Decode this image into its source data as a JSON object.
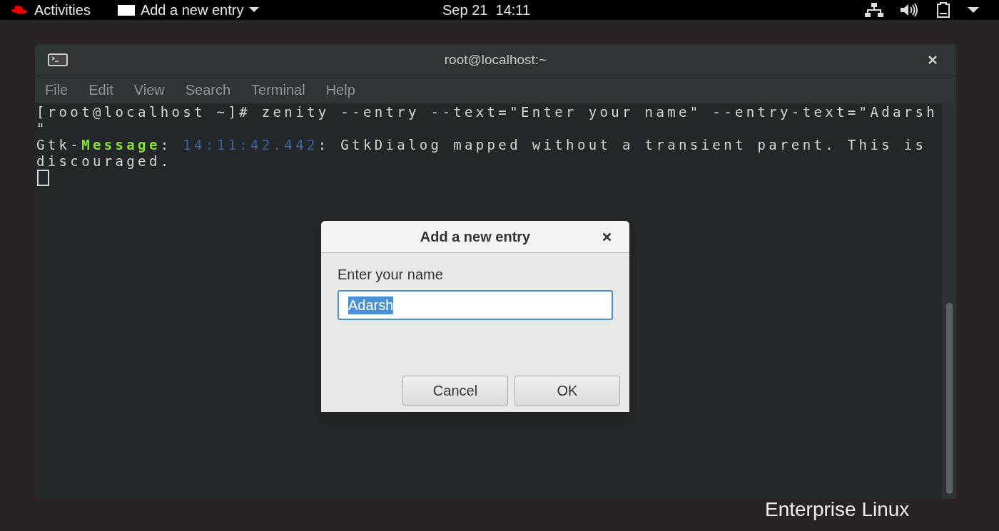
{
  "top_bar": {
    "activities": "Activities",
    "app_menu": "Add a new entry",
    "clock": "Sep 21  14:11"
  },
  "desktop": {
    "brand_text": "Enterprise Linux"
  },
  "terminal": {
    "title": "root@localhost:~",
    "menu": [
      "File",
      "Edit",
      "View",
      "Search",
      "Terminal",
      "Help"
    ],
    "lines": [
      [
        {
          "kind": "plain",
          "text": "[root@localhost ~]# zenity --entry --text=\"Enter your name\" --entry-text=\"Adarsh"
        }
      ],
      [
        {
          "kind": "plain",
          "text": "\""
        }
      ],
      [
        {
          "kind": "plain",
          "text": "Gtk-"
        },
        {
          "kind": "keyword",
          "text": "Message"
        },
        {
          "kind": "plain",
          "text": ": "
        },
        {
          "kind": "time",
          "text": "14:11:42.442"
        },
        {
          "kind": "plain",
          "text": ": GtkDialog mapped without a transient parent. This is"
        }
      ],
      [
        {
          "kind": "plain",
          "text": "discouraged."
        }
      ]
    ]
  },
  "dialog": {
    "title": "Add a new entry",
    "prompt": "Enter your name",
    "entry_value": "Adarsh",
    "buttons": [
      "Cancel",
      "OK"
    ]
  }
}
